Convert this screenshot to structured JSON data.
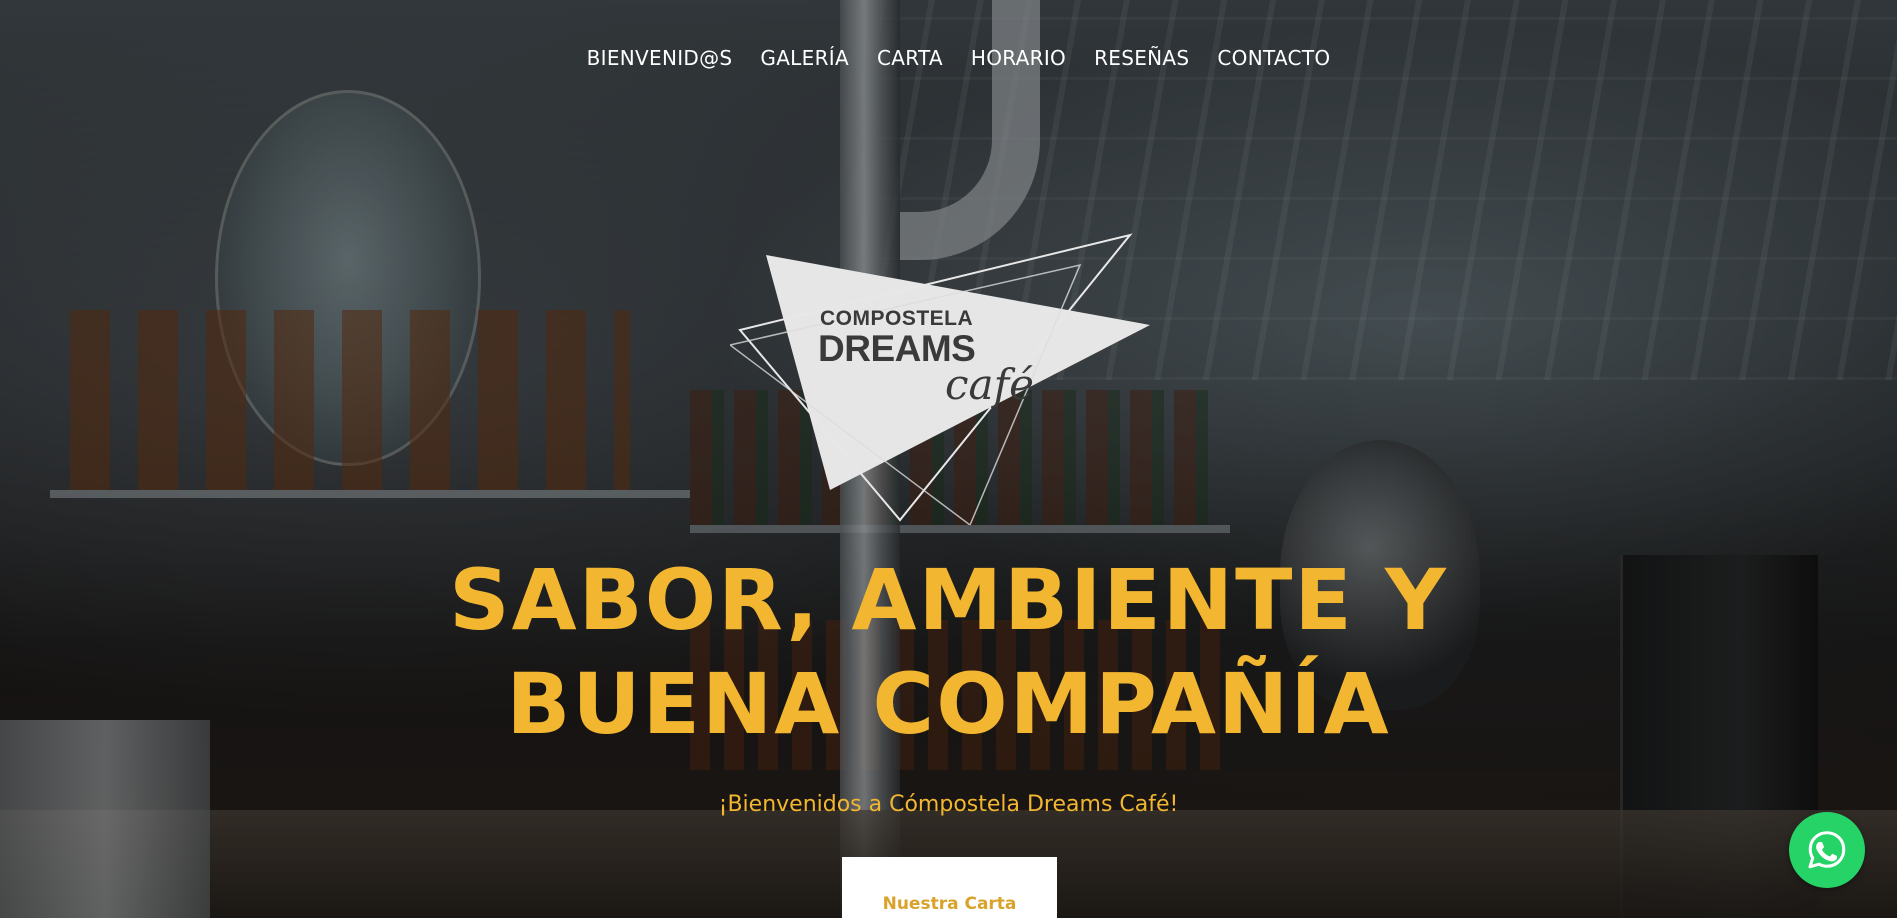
{
  "nav": {
    "items": [
      {
        "label": "BIENVENID@S"
      },
      {
        "label": "GALERÍA"
      },
      {
        "label": "CARTA"
      },
      {
        "label": "HORARIO"
      },
      {
        "label": "RESEÑAS"
      },
      {
        "label": "CONTACTO"
      }
    ]
  },
  "logo": {
    "line1": "COMPOSTELA",
    "line2": "DREAMS",
    "line3": "café"
  },
  "hero": {
    "headline_line1": "SABOR, AMBIENTE Y",
    "headline_line2": "BUENA COMPAÑÍA",
    "subtitle": "¡Bienvenidos a Cómpostela Dreams Café!",
    "cta_label": "Nuestra Carta"
  },
  "floating": {
    "icon": "whatsapp-icon"
  },
  "colors": {
    "accent": "#f2b630",
    "cta_text": "#d9a22b",
    "whatsapp": "#25d366"
  }
}
